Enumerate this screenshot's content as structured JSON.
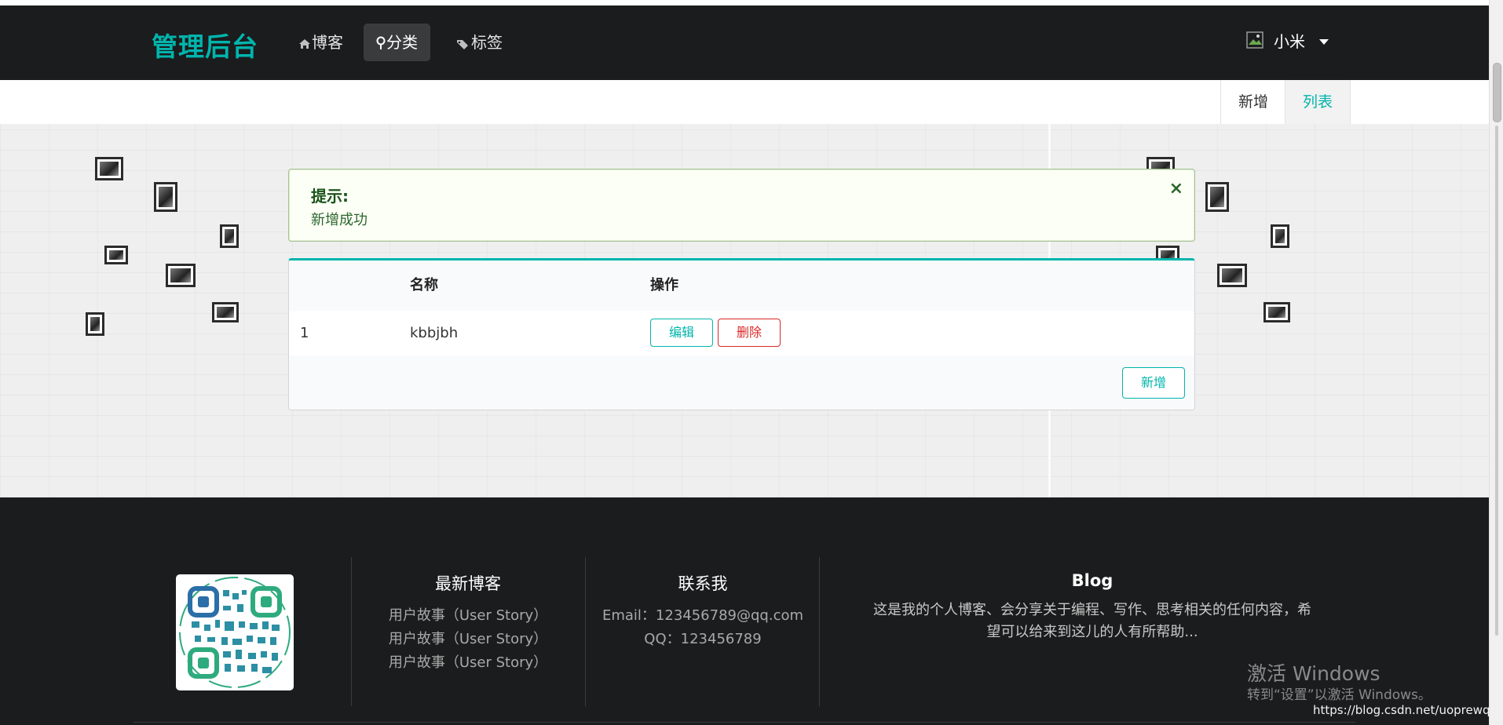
{
  "navbar": {
    "brand": "管理后台",
    "items": [
      {
        "label": "博客",
        "icon": "home-icon"
      },
      {
        "label": "分类",
        "icon": "map-pin-icon",
        "active": true
      },
      {
        "label": "标签",
        "icon": "tags-icon"
      }
    ],
    "user": {
      "name": "小米",
      "icon": "broken-image-icon"
    }
  },
  "submenu": {
    "new_label": "新增",
    "list_label": "列表"
  },
  "alert": {
    "title": "提示:",
    "message": "新增成功",
    "close_glyph": "×"
  },
  "table": {
    "headers": [
      "",
      "名称",
      "操作"
    ],
    "rows": [
      {
        "id": "1",
        "name": "kbbjbh",
        "edit_label": "编辑",
        "delete_label": "删除"
      }
    ],
    "add_label": "新增"
  },
  "footer": {
    "latest": {
      "title": "最新博客",
      "links": [
        "用户故事（User Story）",
        "用户故事（User Story）",
        "用户故事（User Story）"
      ]
    },
    "contact": {
      "title": "联系我",
      "email": "Email：123456789@qq.com",
      "qq": "QQ：123456789"
    },
    "blog": {
      "title": "Blog",
      "description_line1": "这是我的个人博客、会分享关于编程、写作、思考相关的任何内容，希",
      "description_line2": "望可以给来到这儿的人有所帮助..."
    }
  },
  "watermark": {
    "line1": "激活 Windows",
    "line2": "转到“设置”以激活 Windows。"
  },
  "url_overlay": "https://blog.csdn.net/uoprewqsm",
  "colors": {
    "accent": "#00b5ad",
    "danger": "#db2828",
    "navbar_bg": "#1b1c1d",
    "alert_bg": "#fcfff5"
  }
}
